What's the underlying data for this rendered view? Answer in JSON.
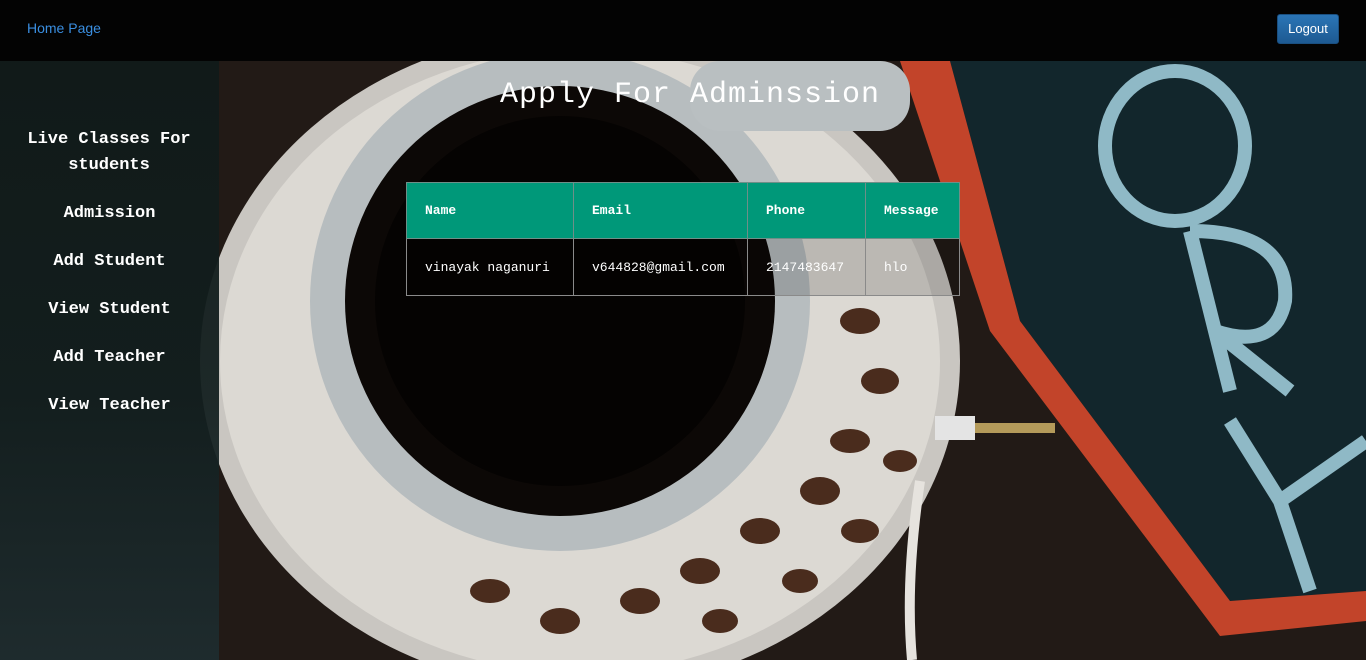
{
  "navbar": {
    "home_link": "Home Page",
    "logout_label": "Logout"
  },
  "sidebar": {
    "items": [
      {
        "label": "Live Classes For students"
      },
      {
        "label": "Admission"
      },
      {
        "label": "Add Student"
      },
      {
        "label": "View Student"
      },
      {
        "label": "Add Teacher"
      },
      {
        "label": "View Teacher"
      }
    ]
  },
  "main": {
    "title": "Apply For Adminssion",
    "table": {
      "headers": [
        "Name",
        "Email",
        "Phone",
        "Message"
      ],
      "rows": [
        [
          "vinayak naganuri",
          "v644828@gmail.com",
          "2147483647",
          "hlo"
        ]
      ]
    }
  },
  "colors": {
    "table_header": "#009879",
    "navbar": "#030303",
    "logout_button": "#2b75b6",
    "link": "#3a8ee0"
  }
}
